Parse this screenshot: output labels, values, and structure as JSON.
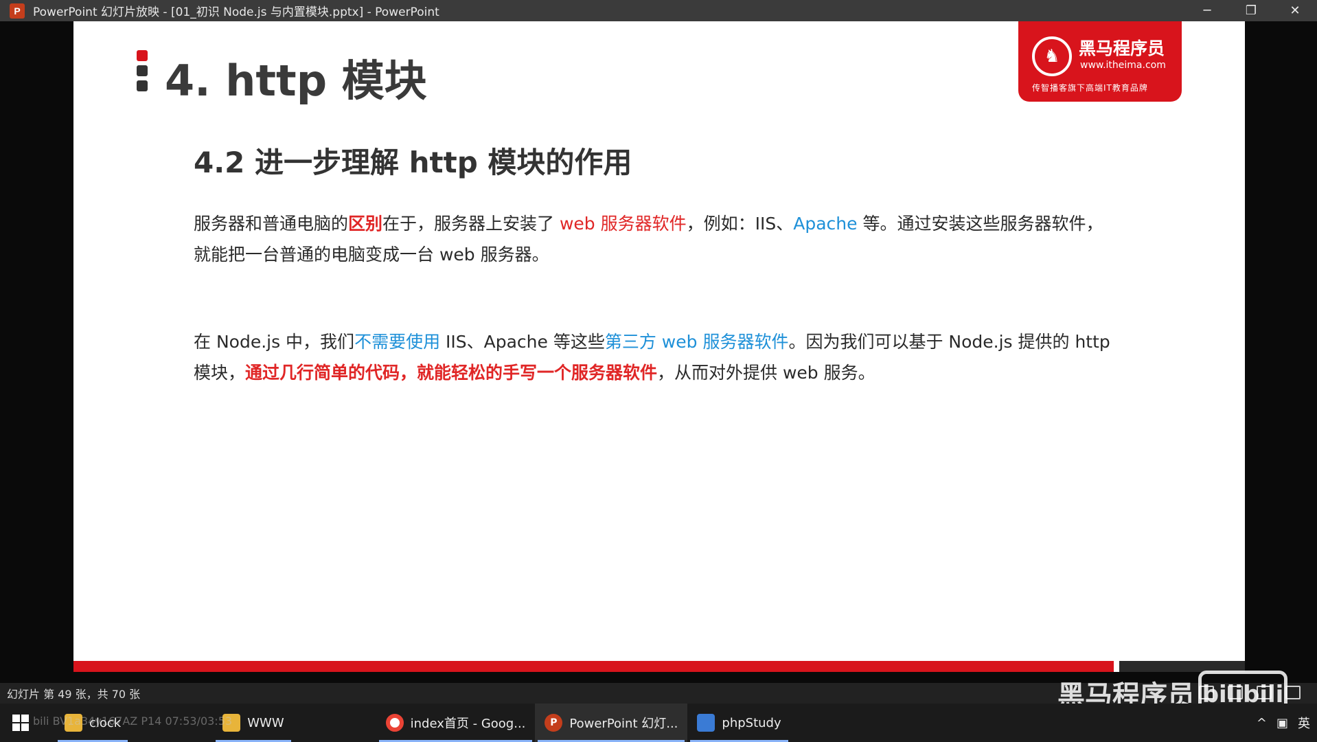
{
  "window": {
    "title": "PowerPoint 幻灯片放映 - [01_初识 Node.js 与内置模块.pptx] - PowerPoint",
    "app_icon": "P",
    "minimize": "─",
    "restore": "❐",
    "close": "✕"
  },
  "slide": {
    "title": "4. http 模块",
    "subtitle": "4.2 进一步理解 http 模块的作用",
    "logo": {
      "brand": "黑马程序员",
      "site": "www.itheima.com",
      "slogan": "传智播客旗下高端IT教育品牌"
    },
    "para1": {
      "t1": "服务器和普通电脑的",
      "t2": "区别",
      "t3": "在于，服务器上安装了 ",
      "t4": "web 服务器软件",
      "t5": "，例如：IIS、",
      "t6": "Apache",
      "t7": " 等。通过安装这些服务器软件，就能把一台普通的电脑变成一台 web 服务器。"
    },
    "para2": {
      "t1": "在 Node.js 中，我们",
      "t2": "不需要使用",
      "t3": " IIS、Apache 等这些",
      "t4": "第三方 web 服务器软件",
      "t5": "。因为我们可以基于 Node.js 提供的 http 模块，",
      "t6": "通过几行简单的代码，就能轻松的手写一个服务器软件",
      "t7": "，从而对外提供 web 服务。"
    }
  },
  "status": {
    "slide_info": "幻灯片 第 49 张，共 70 张"
  },
  "overlay": {
    "watermark": "黑马程序员",
    "bili": "bilibili",
    "faint": "bili BV1a34y167AZ P14 07:53/03:53"
  },
  "taskbar": {
    "items": [
      {
        "label": "clock",
        "icon": "folder-icon"
      },
      {
        "label": "WWW",
        "icon": "folder-icon"
      },
      {
        "label": "index首页 - Goog...",
        "icon": "chrome-icon"
      },
      {
        "label": "PowerPoint 幻灯...",
        "icon": "powerpoint-icon"
      },
      {
        "label": "phpStudy",
        "icon": "phpstudy-icon"
      }
    ],
    "tray_caret": "^",
    "ime": "英"
  },
  "colors": {
    "accent_red": "#d8141c",
    "highlight_red": "#e02626",
    "highlight_blue": "#1e90d8"
  }
}
